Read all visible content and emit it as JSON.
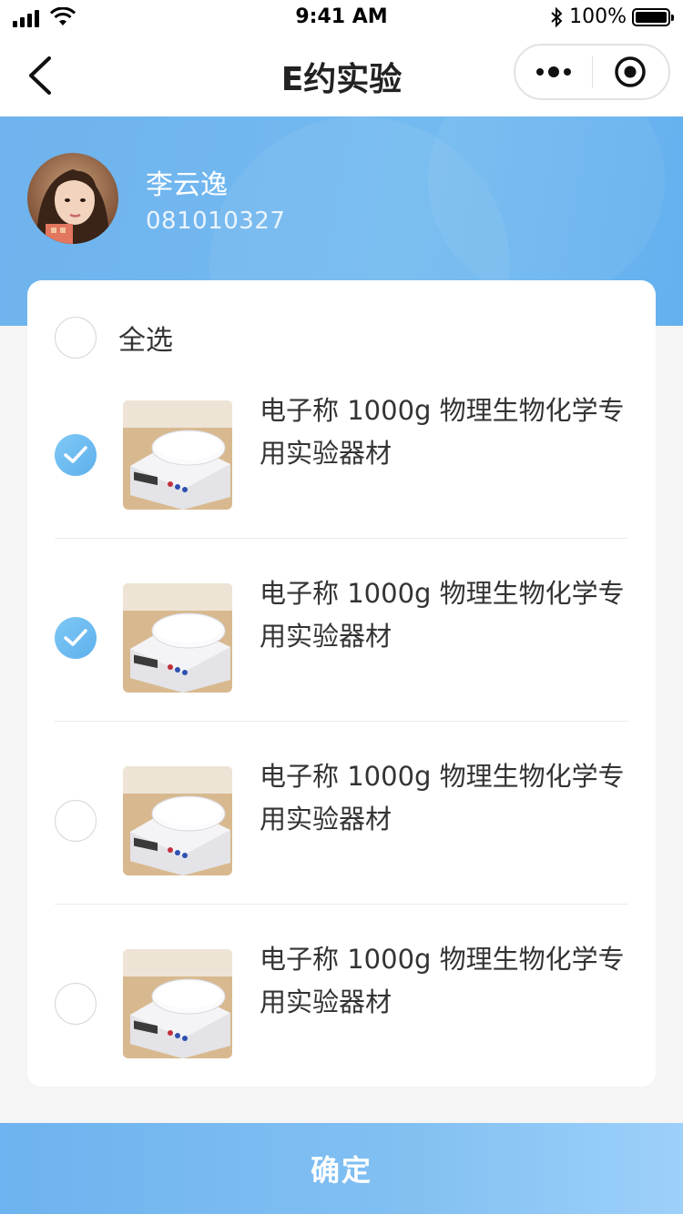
{
  "status_bar": {
    "time": "9:41 AM",
    "battery": "100%",
    "icons": [
      "signal-icon",
      "wifi-icon",
      "bluetooth-icon",
      "battery-icon"
    ]
  },
  "nav": {
    "title": "E约实验",
    "back_icon": "back-chevron-icon",
    "more_icon": "more-dots-icon",
    "close_icon": "target-icon"
  },
  "user": {
    "name": "李云逸",
    "id": "081010327"
  },
  "list": {
    "select_all_label": "全选",
    "select_all_checked": false,
    "items": [
      {
        "title": "电子称 1000g 物理生物化学专用实验器材",
        "checked": true
      },
      {
        "title": "电子称 1000g 物理生物化学专用实验器材",
        "checked": true
      },
      {
        "title": "电子称 1000g 物理生物化学专用实验器材",
        "checked": false
      },
      {
        "title": "电子称 1000g 物理生物化学专用实验器材",
        "checked": false
      }
    ]
  },
  "footer": {
    "confirm_label": "确定"
  },
  "colors": {
    "accent": "#6fb3ee",
    "check": "#5fb0ec"
  }
}
